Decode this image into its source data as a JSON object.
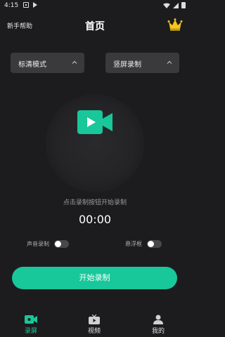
{
  "status_bar": {
    "time": "4:15"
  },
  "header": {
    "help_label": "新手帮助",
    "title": "首页",
    "vip_icon": "crown-icon"
  },
  "selectors": {
    "quality": {
      "label": "标清模式",
      "icon": "chevron-up-icon"
    },
    "orientation": {
      "label": "竖屏录制",
      "icon": "chevron-up-icon"
    }
  },
  "record_area": {
    "icon": "video-camera-icon",
    "hint": "点击录制按钮开始录制",
    "timer": "00:00"
  },
  "toggles": {
    "audio": {
      "label": "声音录制",
      "on": false
    },
    "floating": {
      "label": "悬浮框",
      "on": false
    }
  },
  "start_button": {
    "label": "开始录制"
  },
  "tabs": [
    {
      "label": "录屏",
      "icon": "screen-record-icon",
      "active": true
    },
    {
      "label": "视频",
      "icon": "tv-icon",
      "active": false
    },
    {
      "label": "我的",
      "icon": "user-icon",
      "active": false
    }
  ],
  "colors": {
    "accent": "#18c79a",
    "background": "#1c1c1e",
    "panel": "#3a3a3c",
    "crown": "#f5c518"
  }
}
